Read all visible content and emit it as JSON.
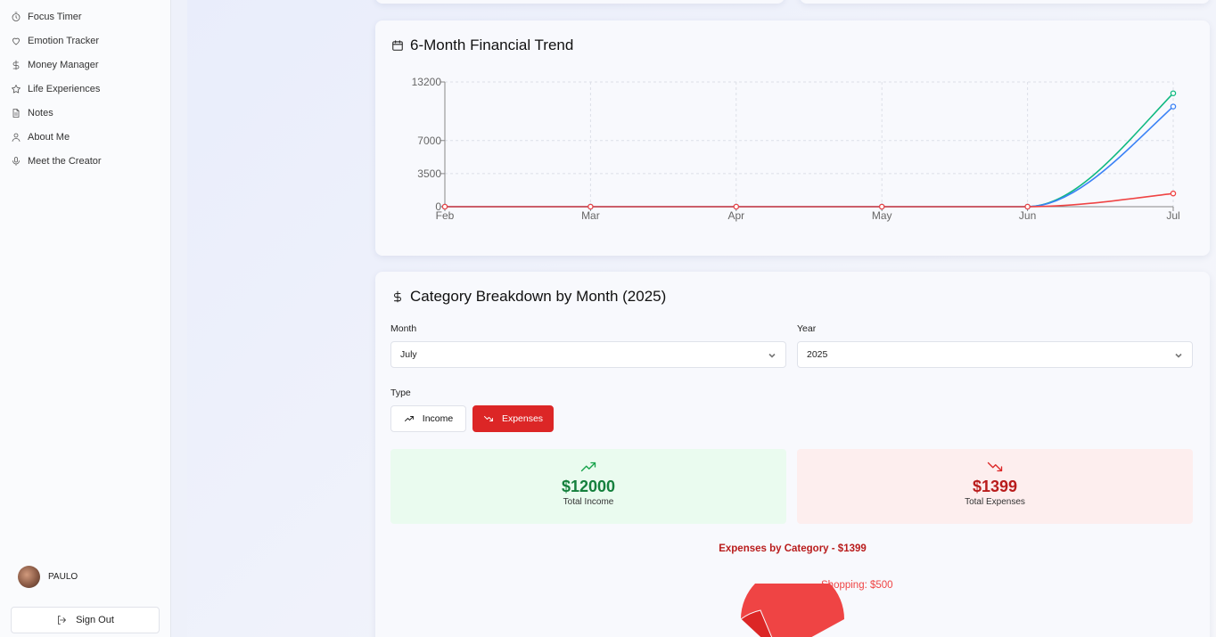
{
  "sidebar": {
    "items": [
      {
        "label": "Focus Timer",
        "icon": "timer-icon"
      },
      {
        "label": "Emotion Tracker",
        "icon": "heart-icon"
      },
      {
        "label": "Money Manager",
        "icon": "dollar-icon"
      },
      {
        "label": "Life Experiences",
        "icon": "star-icon"
      },
      {
        "label": "Notes",
        "icon": "notes-icon"
      },
      {
        "label": "About Me",
        "icon": "user-icon"
      },
      {
        "label": "Meet the Creator",
        "icon": "microphone-icon"
      }
    ],
    "user_name": "PAULO",
    "signout_label": "Sign Out"
  },
  "trend": {
    "title": "6-Month Financial Trend"
  },
  "chart_data": {
    "type": "line",
    "categories": [
      "Feb",
      "Mar",
      "Apr",
      "May",
      "Jun",
      "Jul"
    ],
    "yticks": [
      0,
      3500,
      7000,
      13200
    ],
    "ylim": [
      0,
      13200
    ],
    "grid": true,
    "series": [
      {
        "color": "#10b981",
        "values": [
          0,
          0,
          0,
          0,
          0,
          12000
        ]
      },
      {
        "color": "#3b82f6",
        "values": [
          0,
          0,
          0,
          0,
          0,
          10600
        ]
      },
      {
        "color": "#ef4444",
        "values": [
          0,
          0,
          0,
          0,
          0,
          1399
        ]
      }
    ]
  },
  "breakdown": {
    "title": "Category Breakdown by Month (2025)",
    "month_label": "Month",
    "month_value": "July",
    "year_label": "Year",
    "year_value": "2025",
    "type_label": "Type",
    "income_label": "Income",
    "expenses_label": "Expenses",
    "selected_type": "Expenses",
    "total_income": "$12000",
    "total_income_label": "Total Income",
    "total_expenses": "$1399",
    "total_expenses_label": "Total Expenses",
    "pie_title": "Expenses by Category - $1399",
    "pie_label": "Shopping: $500"
  },
  "colors": {
    "accent_red": "#dc2626",
    "income_green": "#15803d"
  }
}
